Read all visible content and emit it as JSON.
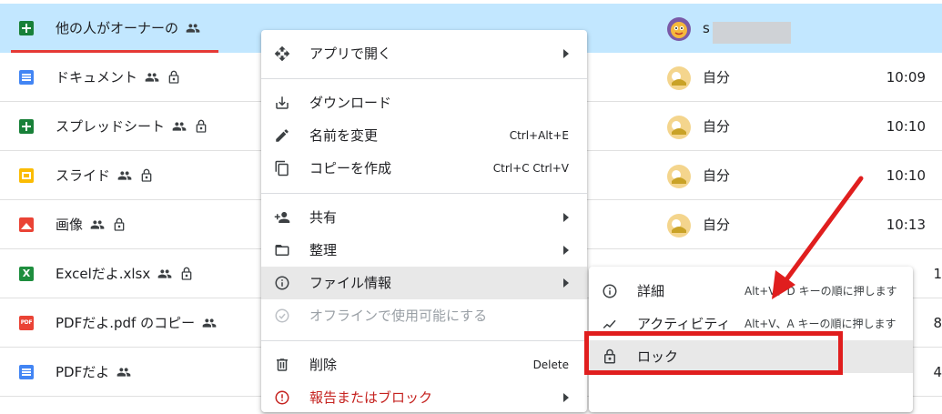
{
  "files": [
    {
      "name": "他の人がオーナーの",
      "icon": "sheets-icon",
      "shared": true,
      "locked": false,
      "owner": "s",
      "time": "",
      "selected": true
    },
    {
      "name": "ドキュメント",
      "icon": "docs-icon",
      "shared": true,
      "locked": true,
      "owner": "自分",
      "time": "10:09"
    },
    {
      "name": "スプレッドシート",
      "icon": "sheets-icon",
      "shared": true,
      "locked": true,
      "owner": "自分",
      "time": "10:10"
    },
    {
      "name": "スライド",
      "icon": "slides-icon",
      "shared": true,
      "locked": true,
      "owner": "自分",
      "time": "10:10"
    },
    {
      "name": "画像",
      "icon": "image-icon",
      "shared": true,
      "locked": true,
      "owner": "自分",
      "time": "10:13"
    },
    {
      "name": "Excelだよ.xlsx",
      "icon": "excel-icon",
      "shared": true,
      "locked": true,
      "owner": "",
      "time": "1"
    },
    {
      "name": "PDFだよ.pdf のコピー",
      "icon": "pdf-icon",
      "shared": true,
      "locked": false,
      "owner": "",
      "time": "8"
    },
    {
      "name": "PDFだよ",
      "icon": "docs-icon",
      "shared": true,
      "locked": false,
      "owner": "",
      "time": "4"
    }
  ],
  "file_icon_text": {
    "excel": "X",
    "pdf": "PDF"
  },
  "context_menu": {
    "open_with": "アプリで開く",
    "download": "ダウンロード",
    "rename": "名前を変更",
    "rename_shortcut": "Ctrl+Alt+E",
    "make_copy": "コピーを作成",
    "make_copy_shortcut": "Ctrl+C Ctrl+V",
    "share": "共有",
    "organize": "整理",
    "file_info": "ファイル情報",
    "offline": "オフラインで使用可能にする",
    "delete": "削除",
    "delete_shortcut": "Delete",
    "report": "報告またはブロック"
  },
  "submenu": {
    "details": "詳細",
    "details_shortcut": "Alt+V、D キーの順に押します",
    "activity": "アクティビティ",
    "activity_shortcut": "Alt+V、A キーの順に押します",
    "lock": "ロック"
  },
  "colors": {
    "selected_row": "#c2e7ff",
    "annotation_red": "#e01e1e",
    "menu_hover": "#e8e8e8"
  }
}
